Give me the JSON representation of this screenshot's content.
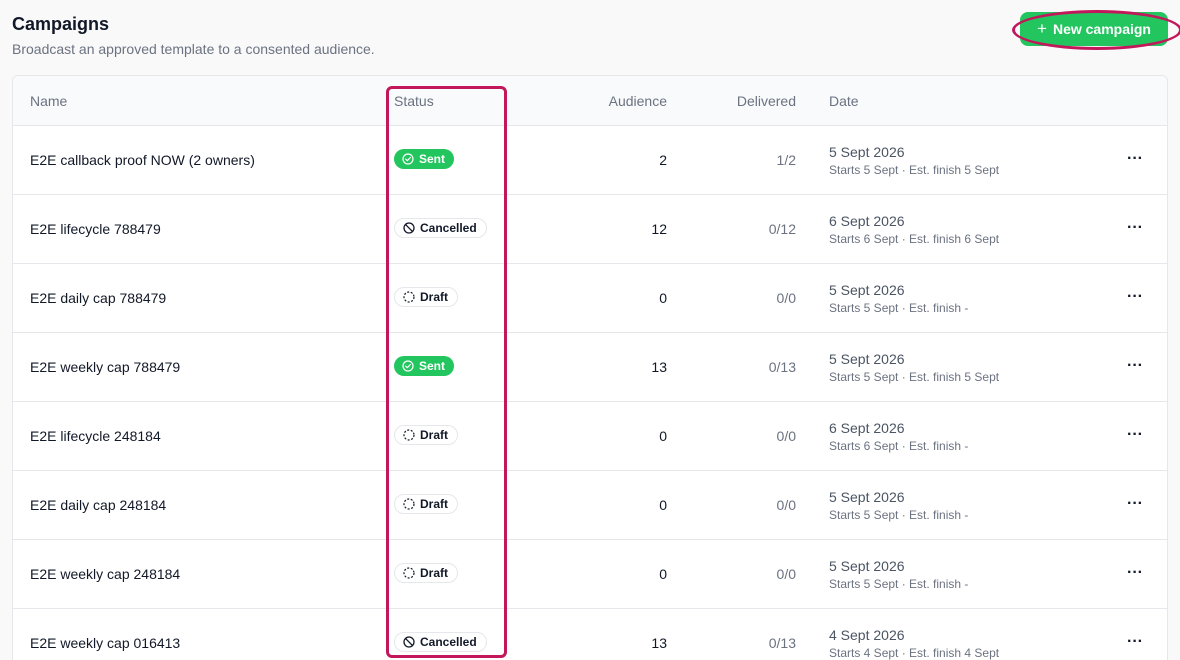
{
  "header": {
    "title": "Campaigns",
    "subtitle": "Broadcast an approved template to a consented audience.",
    "new_button_label": "New campaign",
    "new_button_icon": "plus-icon"
  },
  "colors": {
    "accent": "#22c55e",
    "highlight": "#c2185b"
  },
  "table": {
    "columns": {
      "name": "Name",
      "status": "Status",
      "audience": "Audience",
      "delivered": "Delivered",
      "date": "Date"
    },
    "more_label": "···",
    "rows": [
      {
        "name": "E2E callback proof NOW (2 owners)",
        "status": "Sent",
        "status_kind": "sent",
        "audience": "2",
        "delivered": "1/2",
        "date": "5 Sept 2026",
        "date_detail": "Starts 5 Sept · Est. finish 5 Sept"
      },
      {
        "name": "E2E lifecycle 788479",
        "status": "Cancelled",
        "status_kind": "cancelled",
        "audience": "12",
        "delivered": "0/12",
        "date": "6 Sept 2026",
        "date_detail": "Starts 6 Sept · Est. finish 6 Sept"
      },
      {
        "name": "E2E daily cap 788479",
        "status": "Draft",
        "status_kind": "draft",
        "audience": "0",
        "delivered": "0/0",
        "date": "5 Sept 2026",
        "date_detail": "Starts 5 Sept · Est. finish -"
      },
      {
        "name": "E2E weekly cap 788479",
        "status": "Sent",
        "status_kind": "sent",
        "audience": "13",
        "delivered": "0/13",
        "date": "5 Sept 2026",
        "date_detail": "Starts 5 Sept · Est. finish 5 Sept"
      },
      {
        "name": "E2E lifecycle 248184",
        "status": "Draft",
        "status_kind": "draft",
        "audience": "0",
        "delivered": "0/0",
        "date": "6 Sept 2026",
        "date_detail": "Starts 6 Sept · Est. finish -"
      },
      {
        "name": "E2E daily cap 248184",
        "status": "Draft",
        "status_kind": "draft",
        "audience": "0",
        "delivered": "0/0",
        "date": "5 Sept 2026",
        "date_detail": "Starts 5 Sept · Est. finish -"
      },
      {
        "name": "E2E weekly cap 248184",
        "status": "Draft",
        "status_kind": "draft",
        "audience": "0",
        "delivered": "0/0",
        "date": "5 Sept 2026",
        "date_detail": "Starts 5 Sept · Est. finish -"
      },
      {
        "name": "E2E weekly cap 016413",
        "status": "Cancelled",
        "status_kind": "cancelled",
        "audience": "13",
        "delivered": "0/13",
        "date": "4 Sept 2026",
        "date_detail": "Starts 4 Sept · Est. finish 4 Sept"
      }
    ]
  }
}
